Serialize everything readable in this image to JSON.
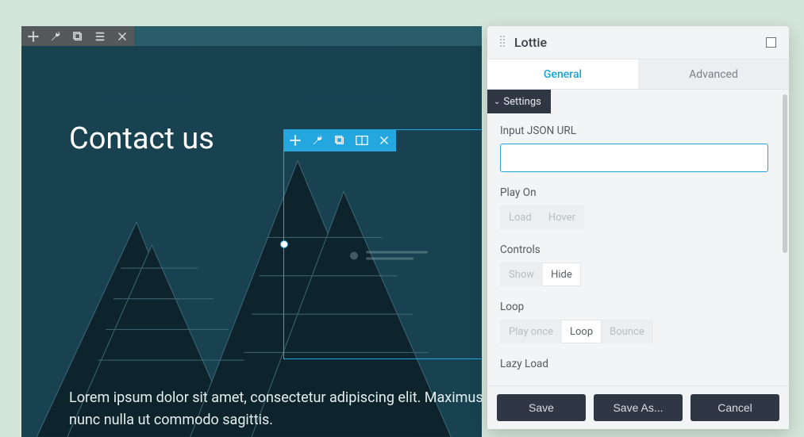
{
  "page": {
    "title": "Contact us",
    "body": "Lorem ipsum dolor sit amet, consectetur adipiscing elit. Maximus nunc nulla ut commodo sagittis."
  },
  "panel": {
    "title": "Lottie",
    "tabs": {
      "general": "General",
      "advanced": "Advanced"
    },
    "section": "Settings",
    "fields": {
      "json_url_label": "Input JSON URL",
      "json_url_value": "",
      "play_on_label": "Play On",
      "play_on_options": {
        "load": "Load",
        "hover": "Hover"
      },
      "controls_label": "Controls",
      "controls_options": {
        "show": "Show",
        "hide": "Hide"
      },
      "loop_label": "Loop",
      "loop_options": {
        "once": "Play once",
        "loop": "Loop",
        "bounce": "Bounce"
      },
      "lazy_label": "Lazy Load"
    },
    "footer": {
      "save": "Save",
      "save_as": "Save As...",
      "cancel": "Cancel"
    }
  },
  "icons": {
    "move": "move-icon",
    "wrench": "wrench-icon",
    "copy": "copy-icon",
    "list": "list-icon",
    "close": "close-icon",
    "columns": "columns-icon",
    "maximize": "maximize-icon"
  }
}
